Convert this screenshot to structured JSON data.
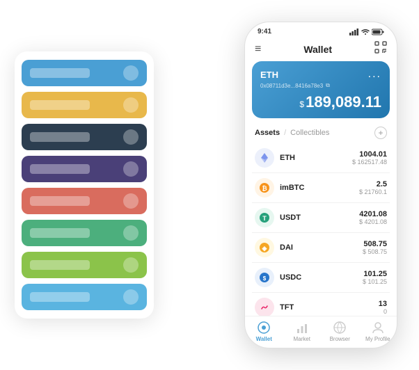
{
  "scene": {
    "background": "#ffffff"
  },
  "cardStack": {
    "items": [
      {
        "color": "card-blue",
        "label": ""
      },
      {
        "color": "card-yellow",
        "label": ""
      },
      {
        "color": "card-dark",
        "label": ""
      },
      {
        "color": "card-purple",
        "label": ""
      },
      {
        "color": "card-red",
        "label": ""
      },
      {
        "color": "card-green",
        "label": ""
      },
      {
        "color": "card-light-green",
        "label": ""
      },
      {
        "color": "card-sky",
        "label": ""
      }
    ]
  },
  "phone": {
    "statusBar": {
      "time": "9:41",
      "signal": "●●●",
      "wifi": "WiFi",
      "battery": "■"
    },
    "header": {
      "menuIcon": "≡",
      "title": "Wallet",
      "scanIcon": "⛶"
    },
    "ethCard": {
      "label": "ETH",
      "dotsLabel": "...",
      "address": "0x08711d3e...8416a78e3",
      "copyIcon": "⧉",
      "currencySymbol": "$",
      "amount": "189,089.11"
    },
    "assetsTabs": {
      "active": "Assets",
      "divider": "/",
      "inactive": "Collectibles",
      "addIcon": "+"
    },
    "tokens": [
      {
        "name": "ETH",
        "iconSymbol": "♦",
        "iconClass": "icon-eth",
        "amount": "1004.01",
        "usd": "$ 162517.48"
      },
      {
        "name": "imBTC",
        "iconSymbol": "₿",
        "iconClass": "icon-imbtc",
        "amount": "2.5",
        "usd": "$ 21760.1"
      },
      {
        "name": "USDT",
        "iconSymbol": "₮",
        "iconClass": "icon-usdt",
        "amount": "4201.08",
        "usd": "$ 4201.08"
      },
      {
        "name": "DAI",
        "iconSymbol": "◈",
        "iconClass": "icon-dai",
        "amount": "508.75",
        "usd": "$ 508.75"
      },
      {
        "name": "USDC",
        "iconSymbol": "©",
        "iconClass": "icon-usdc",
        "amount": "101.25",
        "usd": "$ 101.25"
      },
      {
        "name": "TFT",
        "iconSymbol": "🐦",
        "iconClass": "icon-tft",
        "amount": "13",
        "usd": "0"
      }
    ],
    "bottomNav": [
      {
        "label": "Wallet",
        "icon": "○",
        "active": true
      },
      {
        "label": "Market",
        "icon": "📊",
        "active": false
      },
      {
        "label": "Browser",
        "icon": "👤",
        "active": false
      },
      {
        "label": "My Profile",
        "icon": "👤",
        "active": false
      }
    ]
  }
}
